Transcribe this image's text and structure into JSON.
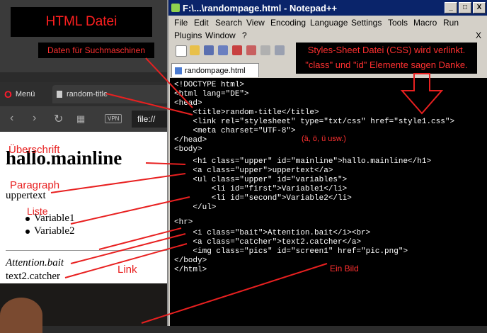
{
  "banner": {
    "title": "HTML Datei"
  },
  "annotations": {
    "daten": "Daten für Suchmaschinen",
    "ueberschrift": "Überschrift",
    "paragraph": "Paragraph",
    "liste": "Liste",
    "link": "Link",
    "css": "Styles-Sheet Datei (CSS) wird verlinkt.",
    "css2": "\"class\" und \"id\" Elemente sagen Danke.",
    "umlaut": "(ä, ö, ü usw.)",
    "bild": "Ein Bild"
  },
  "browser": {
    "menu_label": "Menü",
    "tab_title": "random-title",
    "vpn": "VPN",
    "address": "file://"
  },
  "page": {
    "h1": "hallo.mainline",
    "p": "uppertext",
    "li1": "Variable1",
    "li2": "Variable2",
    "i": "Attention.bait",
    "a": "text2.catcher"
  },
  "notepad": {
    "title": "F:\\...\\randompage.html - Notepad++",
    "menu1": [
      "File",
      "Edit",
      "Search",
      "View",
      "Encoding",
      "Language",
      "Settings",
      "Tools",
      "Macro",
      "Run"
    ],
    "menu2": [
      "Plugins",
      "Window",
      "?"
    ],
    "close_x": "X",
    "tab": "randompage.html",
    "code": [
      "<!DOCTYPE html>",
      "<html lang=\"DE\">",
      "<head>",
      "    <title>random-title</title>",
      "    <link rel=\"stylesheet\" type=\"txt/css\" href=\"style1.css\">",
      "    <meta charset=\"UTF-8\">",
      "</head>",
      "<body>",
      "    <h1 class=\"upper\" id=\"mainline\">hallo.mainline</h1>",
      "    <a class=\"upper\">uppertext</a>",
      "    <ul class=\"upper\" id=\"variables\">",
      "        <li id=\"first\">Variable1</li>",
      "        <li id=\"second\">Variable2</li>",
      "    </ul>",
      "<hr>",
      "    <i class=\"bait\">Attention.bait</i><br>",
      "    <a class=\"catcher\">text2.catcher</a>",
      "    <img class=\"pics\" id=\"screen1\" href=\"pic.png\">",
      "</body>",
      "</html>"
    ]
  }
}
